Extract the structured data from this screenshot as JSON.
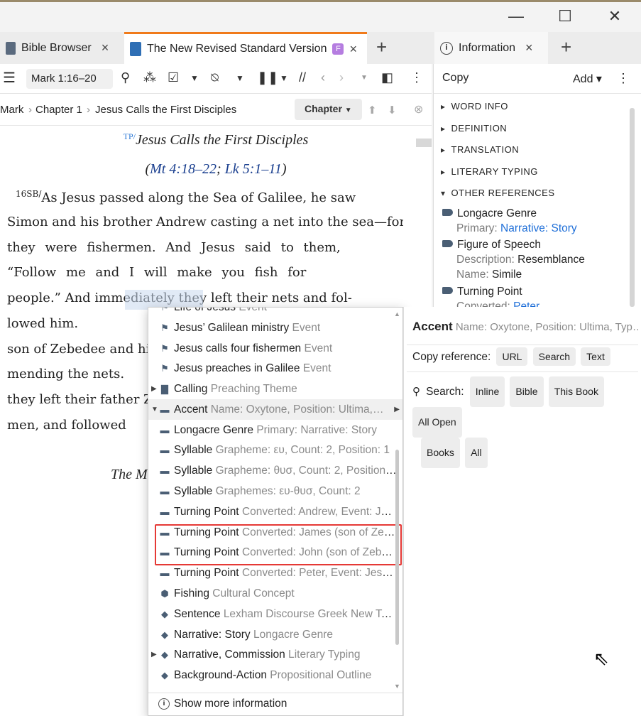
{
  "window": {
    "minimize": "—",
    "maximize": "☐",
    "close": "✕"
  },
  "tabs": [
    {
      "label": "Bible Browser",
      "close": "×"
    },
    {
      "label": "The New Revised Standard Version",
      "badge": "F",
      "close": "×"
    },
    {
      "label": "Information",
      "close": "×"
    }
  ],
  "toolbar": {
    "reference": "Mark 1:16–20"
  },
  "breadcrumb": {
    "book": "Mark",
    "chapter": "Chapter 1",
    "section": "Jesus Calls the First Disciples",
    "chapter_button": "Chapter"
  },
  "bible": {
    "section_tag": "TP/",
    "section_title": "Jesus Calls the First Disciples",
    "parallel_open": "(",
    "parallel1": "Mt 4:18–22",
    "parallel_sep": "; ",
    "parallel2": "Lk 5:1–11",
    "parallel_close": ")",
    "second_title": "The M",
    "lines": [
      "As Jesus passed along the Sea of Galilee, he saw",
      "Simon and his brother Andrew casting a net into the sea—for",
      "they were fishermen. And Jesus said to them,",
      "“Follow me and I will make you fish for",
      "people.” And immediately they left their nets and fol-",
      "lowed him.",
      "son of Zebedee and hi",
      "mending the nets.",
      "they left their father Z",
      "men, and followed"
    ]
  },
  "info_panel": {
    "copy": "Copy",
    "add": "Add ▾",
    "sections": [
      "WORD INFO",
      "DEFINITION",
      "TRANSLATION",
      "LITERARY TYPING",
      "OTHER REFERENCES"
    ],
    "refs": [
      {
        "title": "Longacre Genre",
        "k1": "Primary:",
        "v1": "Narrative: Story"
      },
      {
        "title": "Figure of Speech",
        "k1": "Description:",
        "v1": "Resemblance",
        "k2": "Name:",
        "v2": "Simile"
      },
      {
        "title": "Turning Point",
        "k1": "Converted:",
        "v1": "Peter"
      }
    ]
  },
  "context_menu": {
    "items": [
      {
        "label": "Life of Jesus",
        "meta": "Event",
        "icon": "flag-icon"
      },
      {
        "label": "Jesus’ Galilean ministry",
        "meta": "Event",
        "icon": "flag-icon"
      },
      {
        "label": "Jesus calls four fishermen",
        "meta": "Event",
        "icon": "flag-icon"
      },
      {
        "label": "Jesus preaches in Galilee",
        "meta": "Event",
        "icon": "flag-icon"
      },
      {
        "label": "Calling",
        "meta": "Preaching Theme",
        "icon": "bin-icon"
      },
      {
        "label": "Accent",
        "meta": "Name: Oxytone, Position: Ultima,…",
        "icon": "tag-icon"
      },
      {
        "label": "Longacre Genre",
        "meta": "Primary: Narrative: Story",
        "icon": "tag-icon"
      },
      {
        "label": "Syllable",
        "meta": "Grapheme: ευ, Count: 2, Position: 1",
        "icon": "tag-icon"
      },
      {
        "label": "Syllable",
        "meta": "Grapheme: θυσ, Count: 2, Position: 2",
        "icon": "tag-icon"
      },
      {
        "label": "Syllable",
        "meta": "Graphemes: ευ-θυσ, Count: 2",
        "icon": "tag-icon"
      },
      {
        "label": "Turning Point",
        "meta": "Converted: Andrew, Event: Je…",
        "icon": "tag-icon"
      },
      {
        "label": "Turning Point",
        "meta": "Converted: James (son of Zeb…",
        "icon": "tag-icon"
      },
      {
        "label": "Turning Point",
        "meta": "Converted: John (son of Zebe…",
        "icon": "tag-icon"
      },
      {
        "label": "Turning Point",
        "meta": "Converted: Peter, Event: Jesu…",
        "icon": "tag-icon"
      },
      {
        "label": "Fishing",
        "meta": "Cultural Concept",
        "icon": "hexagon-icon"
      },
      {
        "label": "Sentence",
        "meta": "Lexham Discourse Greek New Test…",
        "icon": "diamond-icon"
      },
      {
        "label": "Narrative: Story",
        "meta": "Longacre Genre",
        "icon": "diamond-icon"
      },
      {
        "label": "Narrative, Commission",
        "meta": "Literary Typing",
        "icon": "diamond-icon"
      },
      {
        "label": "Background-Action",
        "meta": "Propositional Outline",
        "icon": "diamond-icon"
      }
    ],
    "footer": "Show more information"
  },
  "popup": {
    "title": "Accent",
    "meta": "Name: Oxytone, Position: Ultima, Typ…",
    "copy_label": "Copy reference:",
    "copy_buttons": [
      "URL",
      "Search",
      "Text"
    ],
    "search_label": "Search:",
    "search_buttons": [
      "Inline",
      "Bible",
      "This Book",
      "All Open",
      "Books",
      "All"
    ]
  }
}
